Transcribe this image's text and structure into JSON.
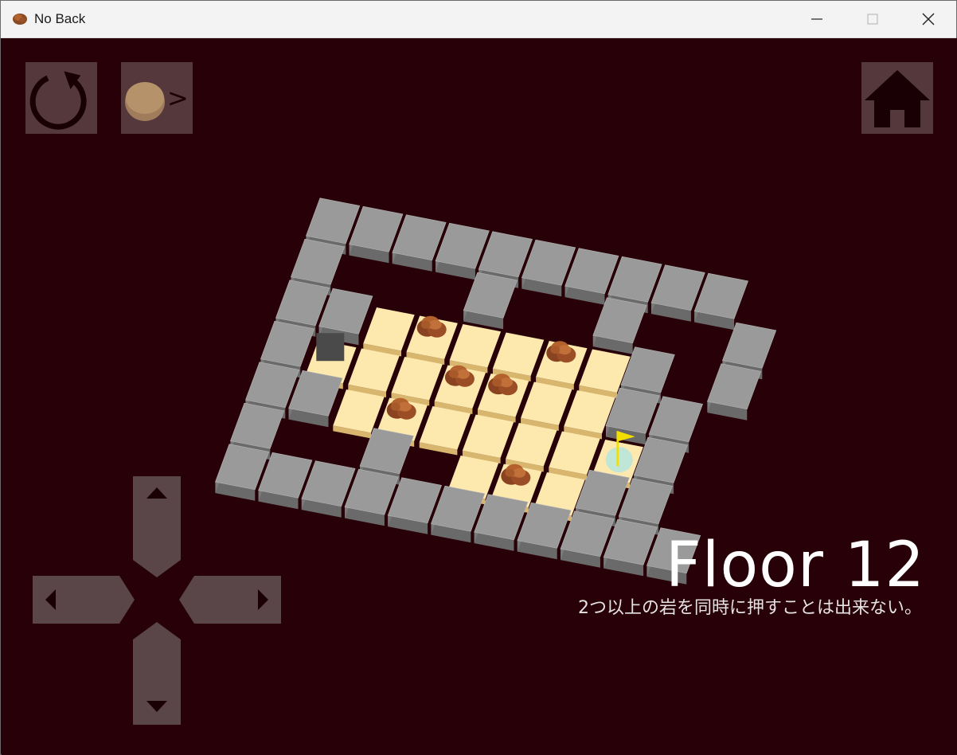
{
  "window": {
    "title": "No Back",
    "icon": "rock-icon",
    "controls": [
      "minimize-icon",
      "maximize-icon",
      "close-icon"
    ]
  },
  "toolbar": {
    "restart_icon": "restart-icon",
    "rock_next_icon": "rock-next-icon",
    "rock_next_glyph": ">",
    "home_icon": "home-icon"
  },
  "dpad": {
    "up_icon": "arrow-up-icon",
    "down_icon": "arrow-down-icon",
    "left_icon": "arrow-left-icon",
    "right_icon": "arrow-right-icon"
  },
  "level": {
    "floor_label": "Floor 12",
    "hint": "2つ以上の岩を同時に押すことは出来ない。"
  },
  "colors": {
    "background": "#270008",
    "wall": "#9a9a9a",
    "floor_tile": "#fde9ae",
    "rock": "#b3622e",
    "goal_glow": "#b8e6dc",
    "flag": "#f2de00",
    "player": "#4a4a4a"
  },
  "board": {
    "legend": {
      "W": "wall",
      "F": "floor",
      "R": "rock",
      "P": "player",
      "G": "goal"
    },
    "rows": [
      "WWWWWWWWWW.",
      "W...W..W..W",
      "WWFRFFRFW.W",
      "WPFFRRFFWW.",
      "WWFRFFFFGW.",
      "W..W.FRFWW.",
      "WWWWWWWWWWW"
    ]
  }
}
